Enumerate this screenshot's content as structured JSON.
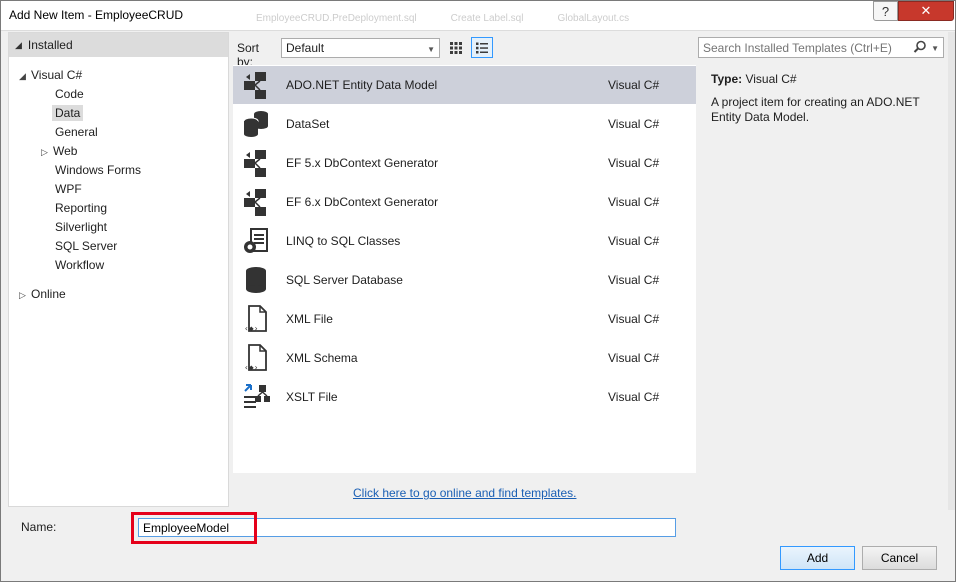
{
  "window": {
    "title": "Add New Item - EmployeeCRUD",
    "help_label": "?",
    "close_label": "✕",
    "background_tabs": [
      "EmployeeCRUD.PreDeployment.sql",
      "Create Label.sql",
      "GlobalLayout.cs"
    ]
  },
  "sidebar": {
    "installed_label": "Installed",
    "group_label": "Visual C#",
    "items": [
      {
        "label": "Code"
      },
      {
        "label": "Data",
        "selected": true
      },
      {
        "label": "General"
      },
      {
        "label": "Web",
        "expandable": true
      },
      {
        "label": "Windows Forms"
      },
      {
        "label": "WPF"
      },
      {
        "label": "Reporting"
      },
      {
        "label": "Silverlight"
      },
      {
        "label": "SQL Server"
      },
      {
        "label": "Workflow"
      }
    ],
    "online_label": "Online"
  },
  "toolbar": {
    "sort_label": "Sort by:",
    "sort_value": "Default"
  },
  "search": {
    "placeholder": "Search Installed Templates (Ctrl+E)"
  },
  "templates": [
    {
      "name": "ADO.NET Entity Data Model",
      "lang": "Visual C#",
      "icon": "entity-model-icon",
      "selected": true
    },
    {
      "name": "DataSet",
      "lang": "Visual C#",
      "icon": "dataset-icon"
    },
    {
      "name": "EF 5.x DbContext Generator",
      "lang": "Visual C#",
      "icon": "entity-model-icon"
    },
    {
      "name": "EF 6.x DbContext Generator",
      "lang": "Visual C#",
      "icon": "entity-model-icon"
    },
    {
      "name": "LINQ to SQL Classes",
      "lang": "Visual C#",
      "icon": "linq-icon"
    },
    {
      "name": "SQL Server Database",
      "lang": "Visual C#",
      "icon": "database-icon"
    },
    {
      "name": "XML File",
      "lang": "Visual C#",
      "icon": "xml-file-icon"
    },
    {
      "name": "XML Schema",
      "lang": "Visual C#",
      "icon": "xml-file-icon"
    },
    {
      "name": "XSLT File",
      "lang": "Visual C#",
      "icon": "xslt-icon"
    }
  ],
  "online_link": "Click here to go online and find templates.",
  "details": {
    "type_label": "Type:",
    "type_value": "Visual C#",
    "description": "A project item for creating an ADO.NET Entity Data Model."
  },
  "name_field": {
    "label": "Name:",
    "value": "EmployeeModel"
  },
  "buttons": {
    "add": "Add",
    "cancel": "Cancel"
  },
  "colors": {
    "selection": "#cdd0da",
    "highlight": "#e5001a",
    "link": "#1a5fb4",
    "close": "#c7382c"
  }
}
